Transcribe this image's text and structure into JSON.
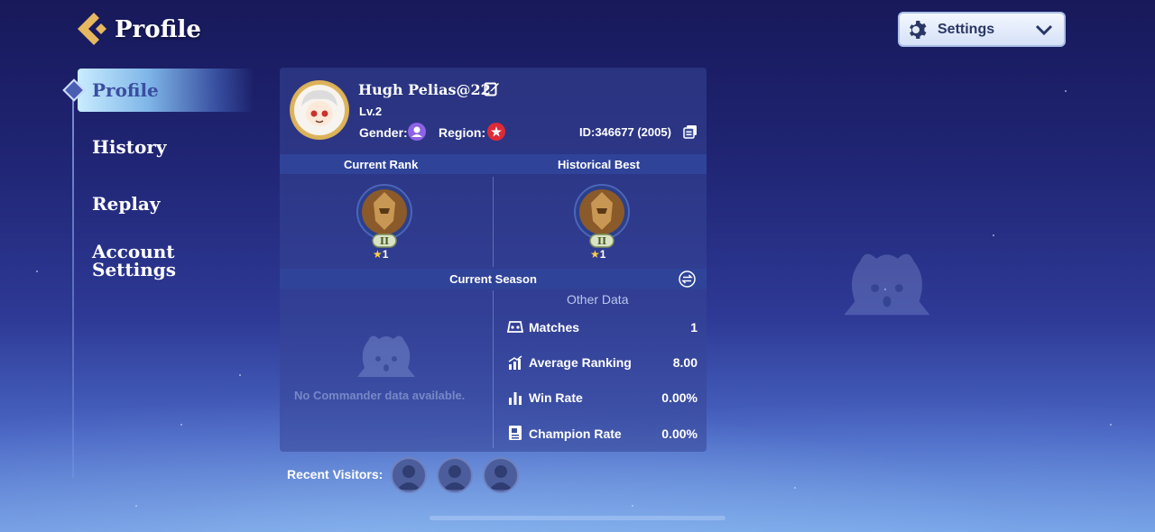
{
  "header": {
    "title": "Profile",
    "settings_label": "Settings"
  },
  "nav": {
    "items": [
      {
        "label": "Profile",
        "active": true
      },
      {
        "label": "History",
        "active": false
      },
      {
        "label": "Replay",
        "active": false
      },
      {
        "label": "Account Settings",
        "active": false
      }
    ]
  },
  "player": {
    "name": "Hugh Pelias@22",
    "level": "Lv.2",
    "gender_label": "Gender:",
    "region_label": "Region:",
    "id": "ID:346677 (2005)"
  },
  "ranks": {
    "current_header": "Current Rank",
    "best_header": "Historical Best",
    "current_tier": "II",
    "current_stars": "1",
    "best_tier": "II",
    "best_stars": "1"
  },
  "season": {
    "header": "Current Season",
    "no_commander": "No Commander data available.",
    "other_title": "Other Data",
    "stats": [
      {
        "icon": "matches-icon",
        "label": "Matches",
        "value": "1"
      },
      {
        "icon": "average-ranking-icon",
        "label": "Average Ranking",
        "value": "8.00"
      },
      {
        "icon": "win-rate-icon",
        "label": "Win Rate",
        "value": "0.00%"
      },
      {
        "icon": "champion-rate-icon",
        "label": "Champion Rate",
        "value": "0.00%"
      }
    ]
  },
  "visitors": {
    "label": "Recent Visitors:",
    "count_shown": 3
  },
  "colors": {
    "accent_gold": "#e0b760",
    "panel_bar": "#2f4399",
    "gender_purple": "#8d62e4",
    "region_red": "#de2a37"
  }
}
